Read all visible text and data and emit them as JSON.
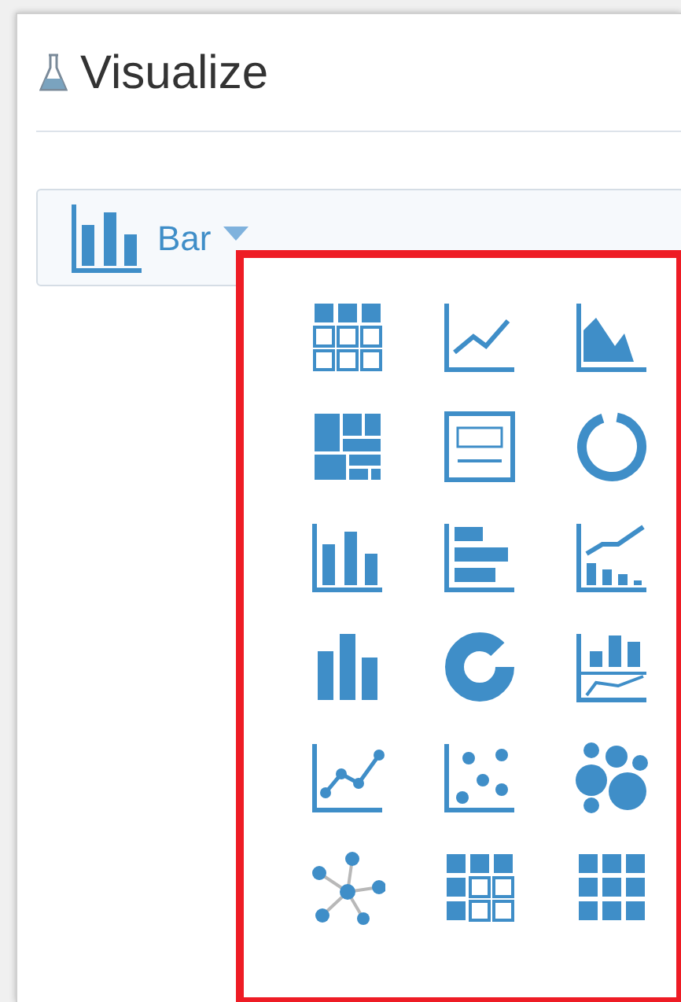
{
  "panel": {
    "title": "Visualize"
  },
  "chart_type_dropdown": {
    "label": "Bar",
    "open": true
  },
  "chart_type_menu": {
    "highlighted": true,
    "items": [
      {
        "kind": "table"
      },
      {
        "kind": "line"
      },
      {
        "kind": "area"
      },
      {
        "kind": "treemap"
      },
      {
        "kind": "tile"
      },
      {
        "kind": "ring"
      },
      {
        "kind": "bar"
      },
      {
        "kind": "hbar"
      },
      {
        "kind": "barline"
      },
      {
        "kind": "plainbar"
      },
      {
        "kind": "donut"
      },
      {
        "kind": "linebar"
      },
      {
        "kind": "linepoints"
      },
      {
        "kind": "scatter"
      },
      {
        "kind": "bubble"
      },
      {
        "kind": "network"
      },
      {
        "kind": "pivot"
      },
      {
        "kind": "heatmap"
      }
    ]
  }
}
